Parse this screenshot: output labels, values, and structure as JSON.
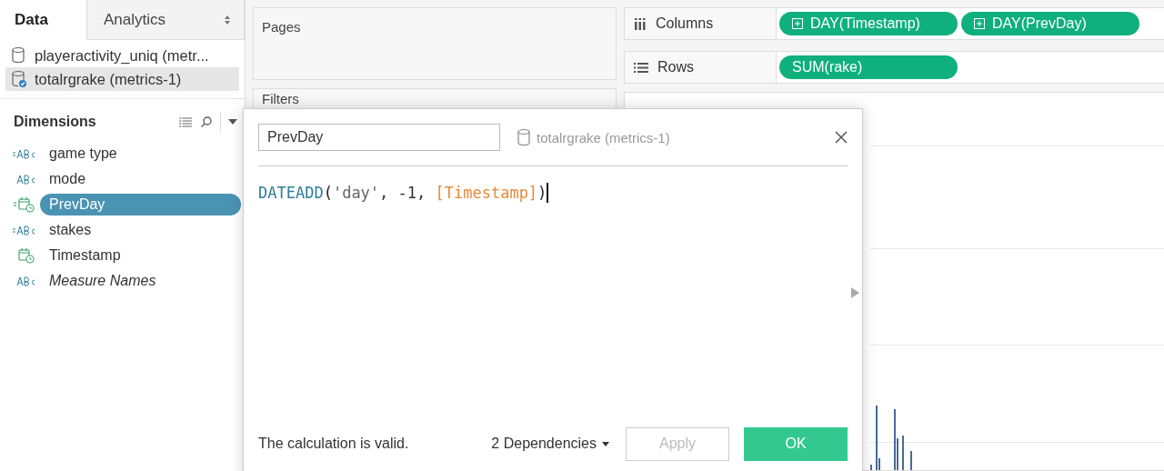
{
  "sidebar": {
    "tabs": [
      {
        "label": "Data",
        "selected": true
      },
      {
        "label": "Analytics",
        "selected": false
      }
    ],
    "data_sources": [
      {
        "name": "playeractivity_uniq (metr...",
        "selected": false,
        "active": false
      },
      {
        "name": "totalrgrake (metrics-1)",
        "selected": true,
        "active": true
      }
    ],
    "dimensions": {
      "title": "Dimensions",
      "fields": [
        {
          "name": "game type",
          "kind": "calc-string",
          "selected": false,
          "italic": false
        },
        {
          "name": "mode",
          "kind": "string",
          "selected": false,
          "italic": false
        },
        {
          "name": "PrevDay",
          "kind": "calc-date",
          "selected": true,
          "italic": false
        },
        {
          "name": "stakes",
          "kind": "calc-string",
          "selected": false,
          "italic": false
        },
        {
          "name": "Timestamp",
          "kind": "date",
          "selected": false,
          "italic": false
        },
        {
          "name": "Measure Names",
          "kind": "string",
          "selected": false,
          "italic": true
        }
      ]
    }
  },
  "pages": {
    "title": "Pages"
  },
  "filters": {
    "title": "Filters"
  },
  "shelves": [
    {
      "label": "Columns",
      "kind": "columns",
      "pills": [
        {
          "label": "DAY(Timestamp)",
          "expandable": true
        },
        {
          "label": "DAY(PrevDay)",
          "expandable": true
        }
      ]
    },
    {
      "label": "Rows",
      "kind": "rows",
      "pills": [
        {
          "label": "SUM(rake)",
          "expandable": false
        }
      ]
    }
  ],
  "dialog": {
    "name": "PrevDay",
    "data_source": "totalrgrake (metrics-1)",
    "formula": [
      {
        "text": "DATEADD",
        "kind": "function"
      },
      {
        "text": "(",
        "kind": "paren"
      },
      {
        "text": "'day'",
        "kind": "string"
      },
      {
        "text": ", -1, ",
        "kind": "punct"
      },
      {
        "text": "[Timestamp]",
        "kind": "field"
      },
      {
        "text": ")",
        "kind": "paren"
      }
    ],
    "status": "The calculation is valid.",
    "dependencies": "2 Dependencies",
    "apply": {
      "label": "Apply",
      "disabled": true
    },
    "ok": {
      "label": "OK",
      "disabled": false
    }
  }
}
